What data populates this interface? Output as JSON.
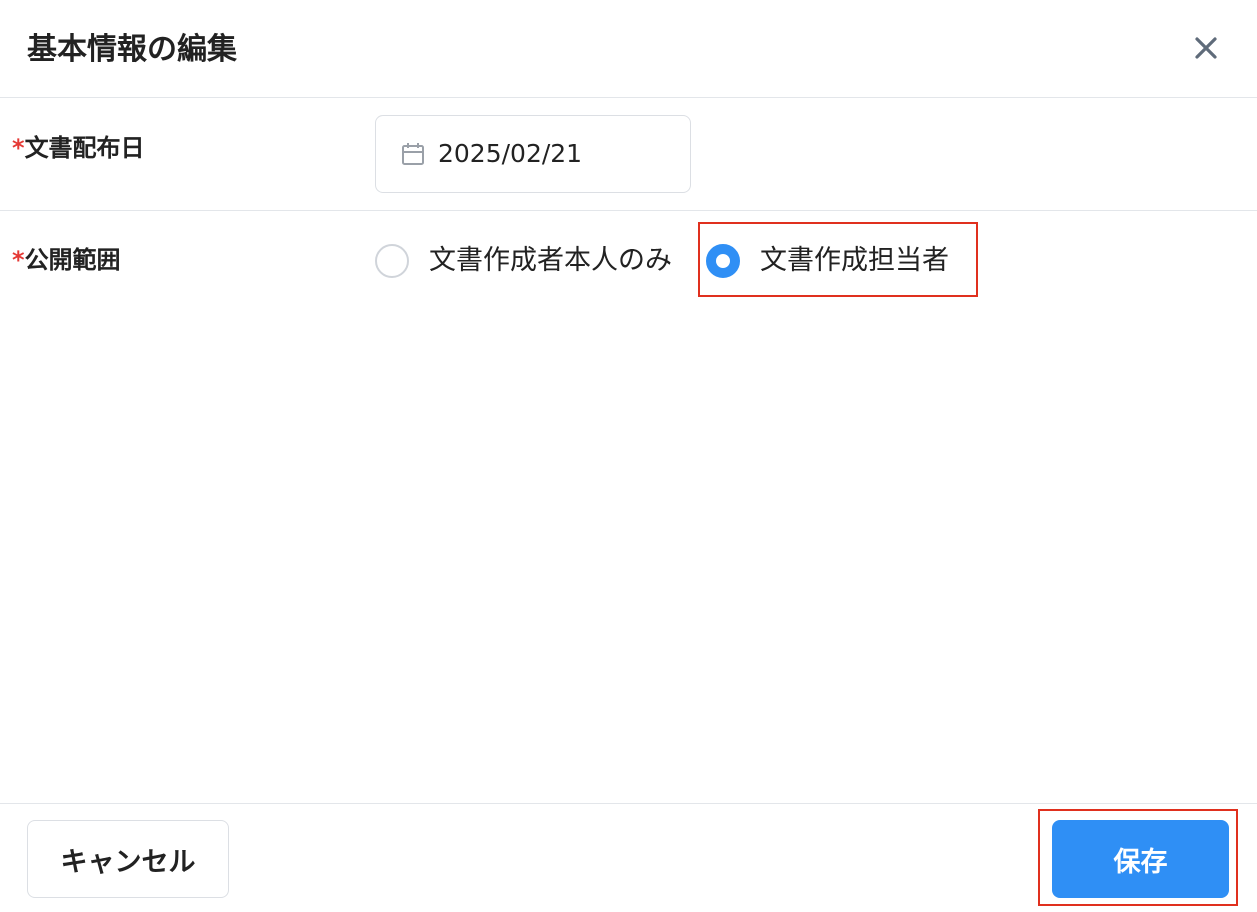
{
  "dialog": {
    "title": "基本情報の編集",
    "close_icon": "close-icon"
  },
  "fields": {
    "distribution_date": {
      "required_mark": "*",
      "label": "文書配布日",
      "icon": "calendar-icon",
      "value": "2025/02/21"
    },
    "visibility": {
      "required_mark": "*",
      "label": "公開範囲",
      "options": [
        {
          "label": "文書作成者本人のみ",
          "selected": false
        },
        {
          "label": "文書作成担当者",
          "selected": true
        }
      ]
    }
  },
  "footer": {
    "cancel_label": "キャンセル",
    "save_label": "保存"
  },
  "colors": {
    "accent": "#2f8ff5",
    "required": "#e53935",
    "highlight": "#e0301e"
  }
}
